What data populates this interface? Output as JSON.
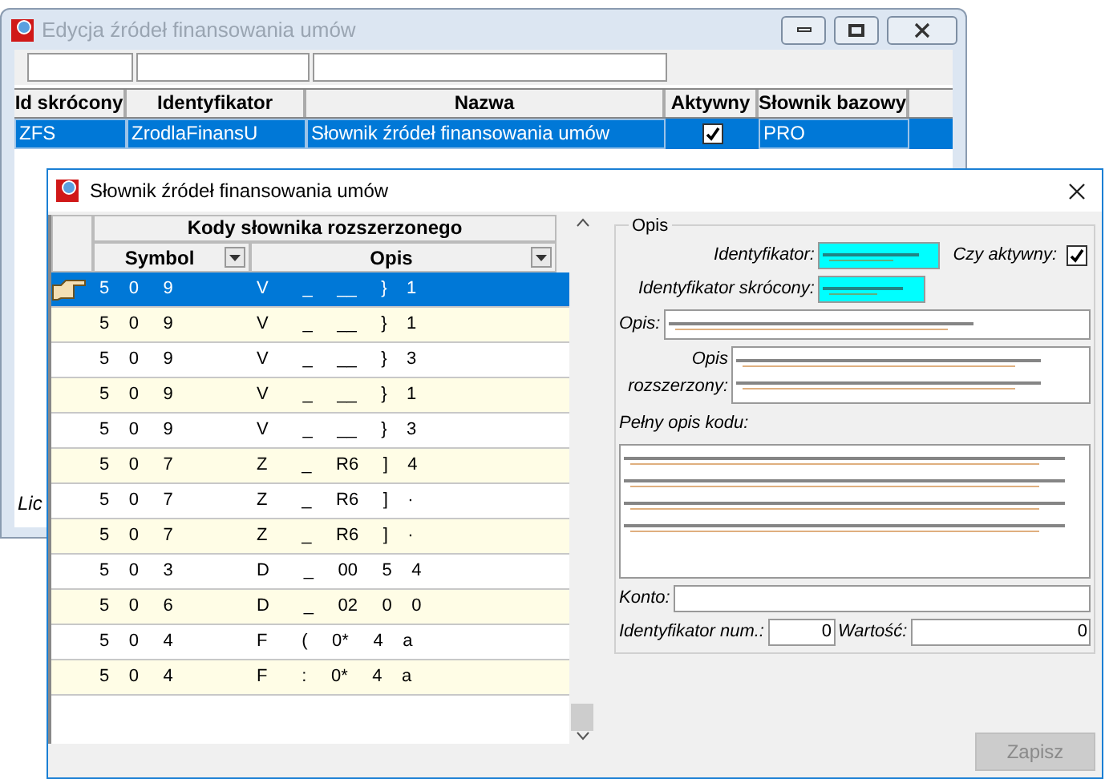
{
  "back_window": {
    "title": "Edycja źródeł finansowania umów",
    "columns": [
      "Id skrócony",
      "Identyfikator",
      "Nazwa",
      "Aktywny",
      "Słownik bazowy"
    ],
    "rows": [
      {
        "cells": [
          "ZFS",
          "ZrodlaFinansU",
          "Słownik źródeł finansowania umów"
        ],
        "active": true,
        "base": "PRO",
        "selected": true
      }
    ],
    "footer_label": "Lic"
  },
  "dialog": {
    "title": "Słownik źródeł finansowania umów",
    "group_header": "Kody słownika rozszerzonego",
    "columns": [
      "Symbol",
      "Opis"
    ],
    "rows": [
      {
        "selected": true,
        "cells": [
          "5    0     9",
          "V       _     __     }    1"
        ]
      },
      {
        "selected": false,
        "cells": [
          "5    0     9",
          "V       _     __     }    1"
        ]
      },
      {
        "selected": false,
        "cells": [
          "5    0     9",
          "V       _     __     }    3"
        ]
      },
      {
        "selected": false,
        "cells": [
          "5    0     9",
          "V       _     __     }    1"
        ]
      },
      {
        "selected": false,
        "cells": [
          "5    0     9",
          "V       _     __     }    3"
        ]
      },
      {
        "selected": false,
        "cells": [
          "5    0     7",
          "Z       _     R6     ]    4"
        ]
      },
      {
        "selected": false,
        "cells": [
          "5    0     7",
          "Z       _     R6     ]    ·"
        ]
      },
      {
        "selected": false,
        "cells": [
          "5    0     7",
          "Z       _     R6     ]    ·"
        ]
      },
      {
        "selected": false,
        "cells": [
          "5    0     3",
          "D       _     00     5    4"
        ]
      },
      {
        "selected": false,
        "cells": [
          "5    0     6",
          "D       _     02     0    0"
        ]
      },
      {
        "selected": false,
        "cells": [
          "5    0     4",
          "F       (     0*     4    a"
        ]
      },
      {
        "selected": false,
        "cells": [
          "5    0     4",
          "F       :     0*     4    a"
        ]
      }
    ],
    "form": {
      "group": "Opis",
      "identyfikator_label": "Identyfikator:",
      "aktywny_label": "Czy aktywny:",
      "aktywny": true,
      "skrocony_label": "Identyfikator skrócony:",
      "opis_label": "Opis:",
      "rozszerzony_label": [
        "Opis",
        "rozszerzony:"
      ],
      "pelny_label": "Pełny opis kodu:",
      "konto_label": "Konto:",
      "num_label": "Identyfikator num.:",
      "num_value": "0",
      "wartosc_label": "Wartość:",
      "wartosc_value": "0"
    },
    "save_button": {
      "label": "Zapisz",
      "disabled": true
    }
  }
}
